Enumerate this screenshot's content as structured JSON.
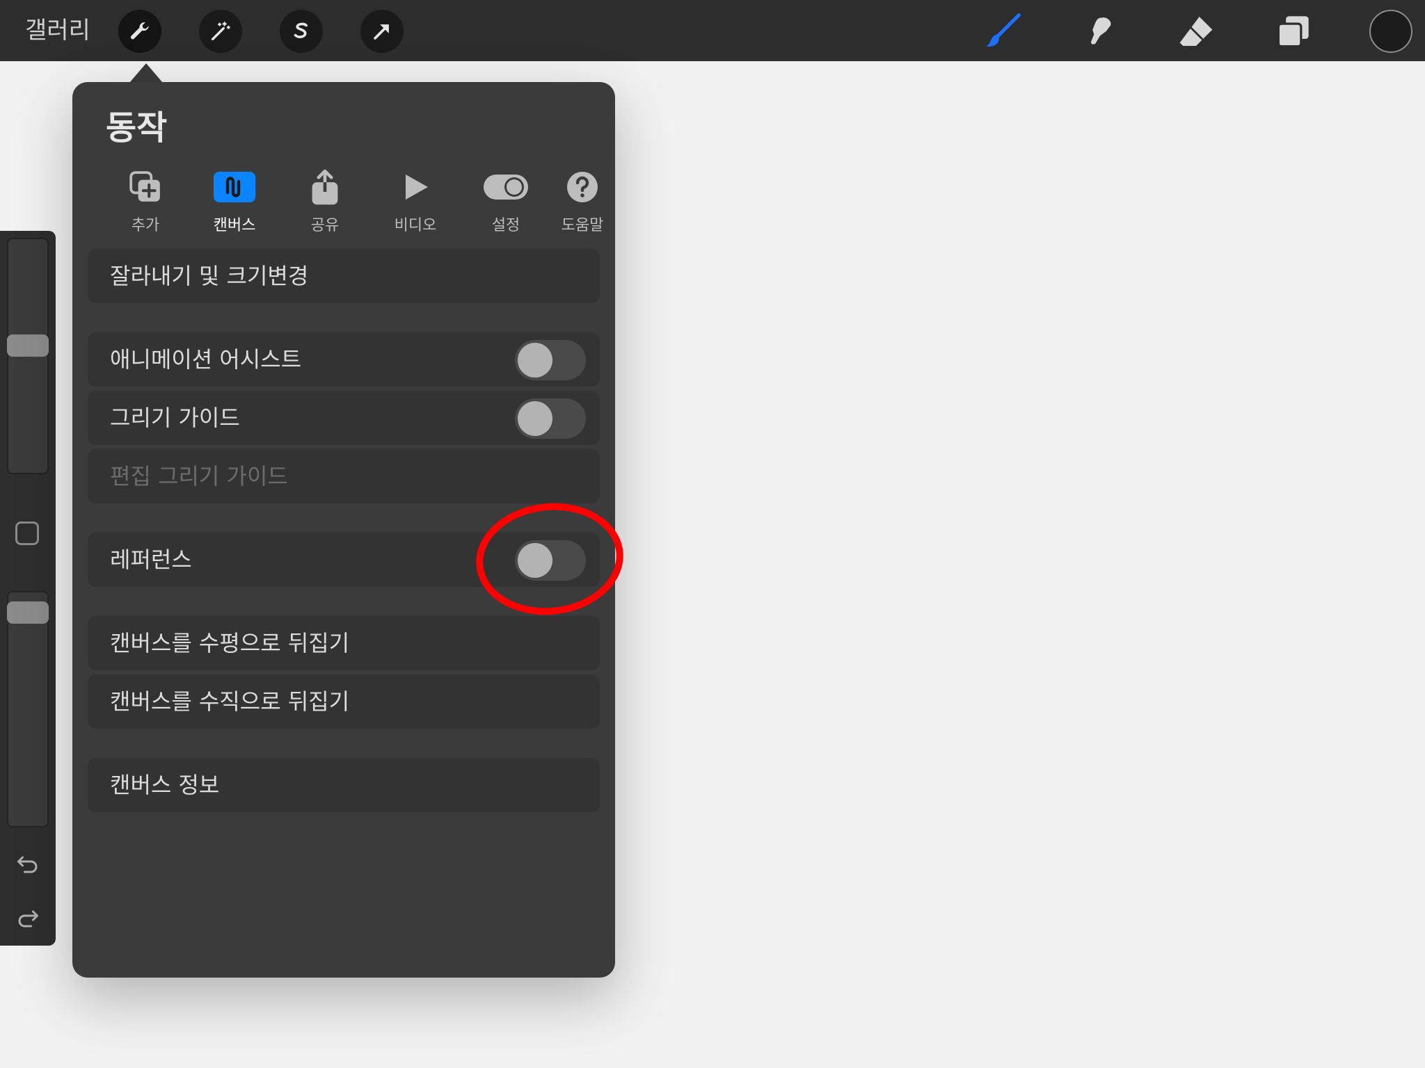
{
  "topbar": {
    "gallery_label": "갤러리",
    "left_tools": [
      "wrench-icon",
      "magic-wand-icon",
      "selection-s-icon",
      "transform-arrow-icon"
    ],
    "right_tools": [
      "brush-icon",
      "smudge-icon",
      "eraser-icon",
      "layers-icon"
    ],
    "active_brush_color": "#1f6fff",
    "current_color": "#1c1c1c"
  },
  "panel": {
    "title": "동작",
    "tabs": [
      {
        "label": "추가",
        "icon": "add-icon",
        "active": false
      },
      {
        "label": "캔버스",
        "icon": "canvas-icon",
        "active": true
      },
      {
        "label": "공유",
        "icon": "share-icon",
        "active": false
      },
      {
        "label": "비디오",
        "icon": "video-play-icon",
        "active": false
      },
      {
        "label": "설정",
        "icon": "settings-toggle-icon",
        "active": false
      },
      {
        "label": "도움말",
        "icon": "help-icon",
        "active": false
      }
    ],
    "rows": {
      "crop_resize": "잘라내기 및 크기변경",
      "animation_assist": "애니메이션 어시스트",
      "drawing_guide": "그리기 가이드",
      "edit_drawing_guide": "편집 그리기 가이드",
      "reference": "레퍼런스",
      "flip_horizontal": "캔버스를 수평으로 뒤집기",
      "flip_vertical": "캔버스를 수직으로 뒤집기",
      "canvas_info": "캔버스 정보"
    },
    "toggles": {
      "animation_assist": false,
      "drawing_guide": false,
      "reference": false
    },
    "accent_color": "#0a84ff",
    "annotation_color": "#ff0000"
  },
  "sidebar": {
    "brush_size_level": 0.55,
    "opacity_level": 0.95,
    "undo_icon": "undo-icon",
    "redo_icon": "redo-icon"
  }
}
